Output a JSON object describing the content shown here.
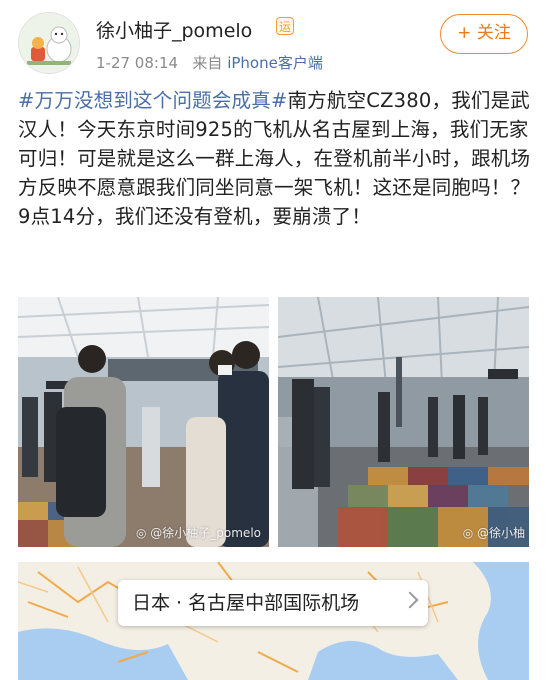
{
  "post": {
    "username": "徐小柚子_pomelo",
    "badge": "运",
    "time": "1-27 08:14",
    "source_prefix": "来自",
    "source_client": "iPhone客户端",
    "follow_label": "+ 关注",
    "hashtag1": "#万万没想到这个问题会成真#",
    "body_line1_tail": "南方航空",
    "body_rest": "CZ380，我们是武汉人！今天东京时间925的飞机从名古屋到上海，我们无家可归！可是就是这么一群上海人，在登机前半小时，跟机场方反映不愿意跟我们同坐同意一架飞机！这还是同胞吗！？ 9点14分，我们还没有登机，要崩溃了！"
  },
  "photos": [
    {
      "name": "airport-gate-photo-left",
      "watermark": "@徐小柚子_pomelo"
    },
    {
      "name": "airport-gate-photo-right",
      "watermark": "@徐小柚"
    }
  ],
  "location": {
    "label": "日本 · 名古屋中部国际机场"
  },
  "colors": {
    "link": "#4a6ea8",
    "follow": "#f07a1a",
    "badge": "#f2a12f"
  },
  "icons": {
    "follow": "plus-icon",
    "location_chevron": "chevron-right-icon",
    "watermark": "weibo-icon"
  }
}
